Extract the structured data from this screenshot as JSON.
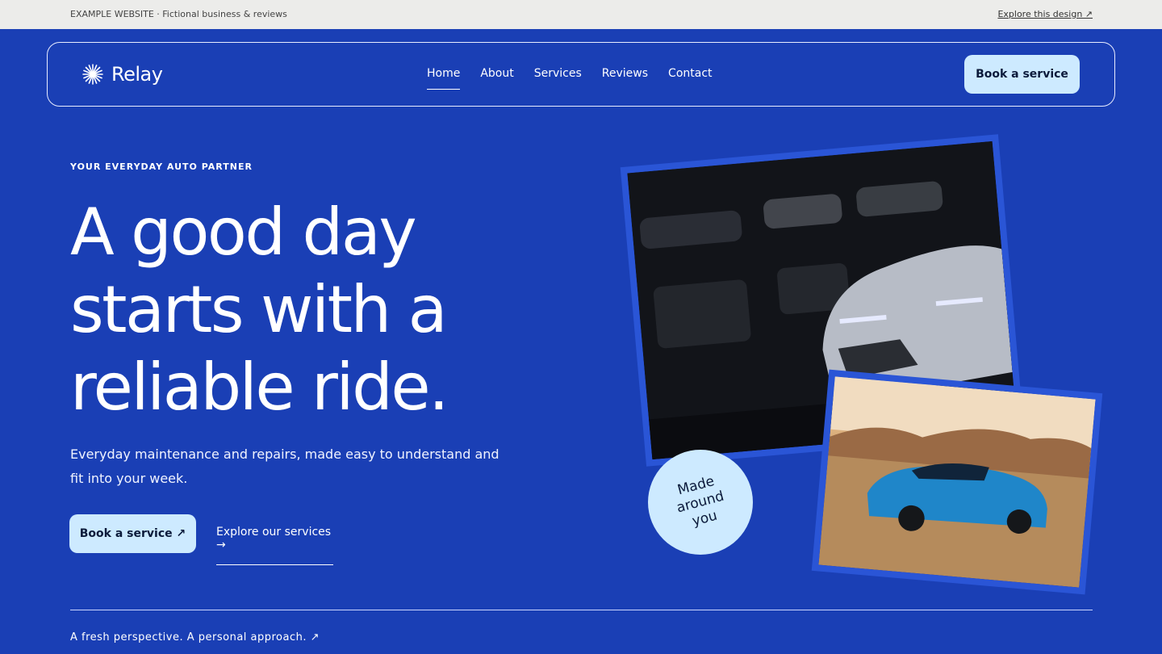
{
  "topbar": {
    "left_text": "EXAMPLE WEBSITE · Fictional business & reviews",
    "right_link": "Explore this design ↗"
  },
  "nav": {
    "brand": "Relay",
    "items": [
      {
        "label": "Home",
        "active": true
      },
      {
        "label": "About"
      },
      {
        "label": "Services"
      },
      {
        "label": "Reviews"
      },
      {
        "label": "Contact"
      }
    ],
    "cta": "Book a service"
  },
  "hero": {
    "eyebrow": "YOUR EVERYDAY AUTO PARTNER",
    "headline": "A good day starts with a reliable ride.",
    "subcopy": "Everyday maintenance and repairs, made easy to understand and fit into your week.",
    "primary_cta": "Book a service ↗",
    "secondary_cta": "Explore our services →",
    "badge": "Made around you"
  },
  "footer": {
    "tagline": "A fresh perspective. A personal approach. ↗"
  },
  "colors": {
    "background": "#1a3fb5",
    "accent": "#cdeaff",
    "topbar": "#ececea"
  },
  "icons": {
    "logo": "starburst-icon"
  }
}
